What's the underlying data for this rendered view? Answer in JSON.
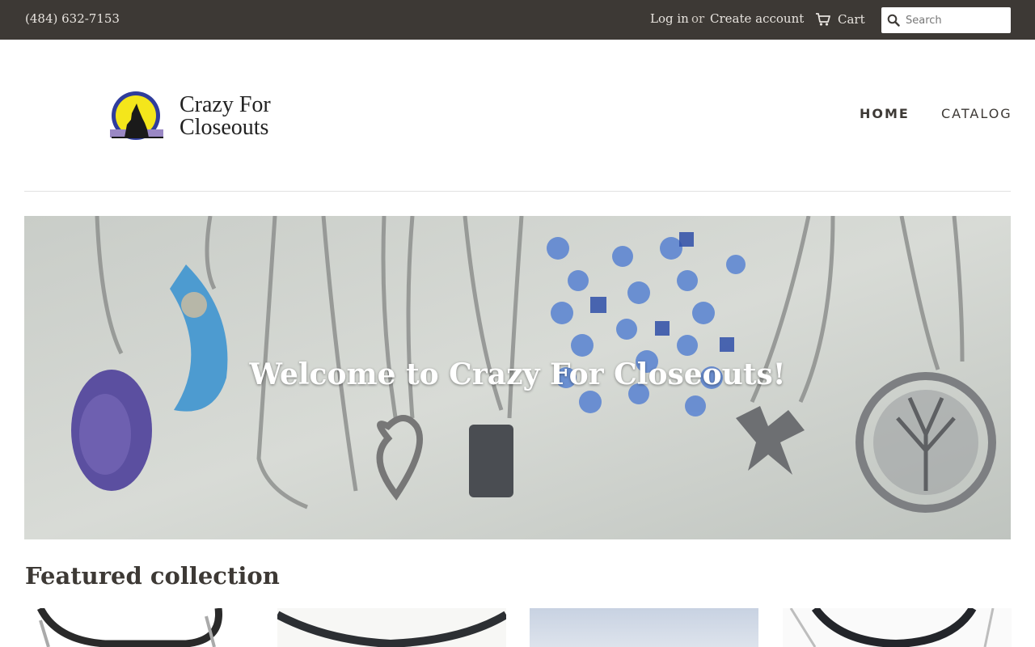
{
  "topbar": {
    "phone": "(484) 632-7153",
    "login": "Log in",
    "or": "or",
    "create_account": "Create account",
    "cart": "Cart",
    "search_placeholder": "Search"
  },
  "logo": {
    "line1": "Crazy For",
    "line2": "Closeouts"
  },
  "nav": {
    "home": "HOME",
    "catalog": "CATALOG"
  },
  "hero": {
    "title": "Welcome to Crazy For Closeouts!"
  },
  "featured": {
    "title": "Featured collection"
  },
  "icons": {
    "cart": "cart-icon",
    "search": "search-icon"
  },
  "colors": {
    "topbar_bg": "#3d3935",
    "topbar_text": "#e8e4df",
    "nav_text": "#3d3935"
  }
}
